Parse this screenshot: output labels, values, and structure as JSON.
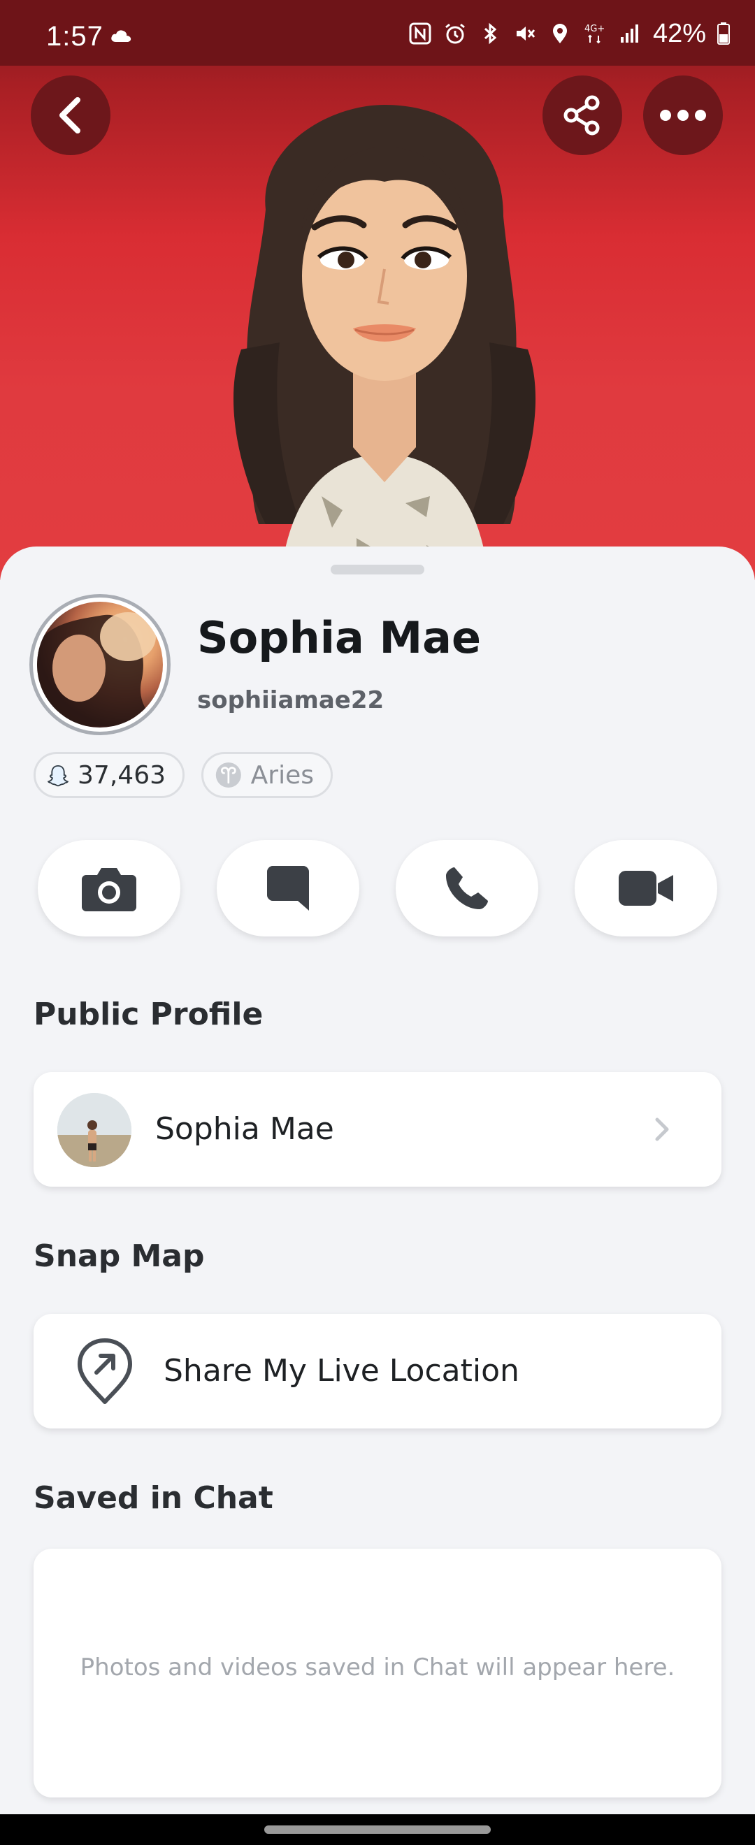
{
  "status_bar": {
    "time": "1:57",
    "battery": "42%",
    "network": "4G+"
  },
  "header": {
    "back_icon": "chevron-left-icon",
    "share_icon": "share-icon",
    "more_icon": "more-horizontal-icon"
  },
  "profile": {
    "name": "Sophia Mae",
    "username": "sophiiamae22",
    "snap_score": "37,463",
    "zodiac": "Aries"
  },
  "actions": [
    {
      "name": "camera",
      "icon": "camera-icon"
    },
    {
      "name": "chat",
      "icon": "chat-icon"
    },
    {
      "name": "call",
      "icon": "phone-icon"
    },
    {
      "name": "video",
      "icon": "video-icon"
    }
  ],
  "sections": {
    "public_profile": {
      "title": "Public Profile",
      "item_label": "Sophia Mae"
    },
    "snap_map": {
      "title": "Snap Map",
      "item_label": "Share My Live Location"
    },
    "saved_in_chat": {
      "title": "Saved in Chat",
      "empty_text": "Photos and videos saved in Chat will appear here."
    }
  },
  "colors": {
    "hero_red": "#e03a3f",
    "dark_red": "#6d171b",
    "sheet_bg": "#f3f4f7"
  }
}
